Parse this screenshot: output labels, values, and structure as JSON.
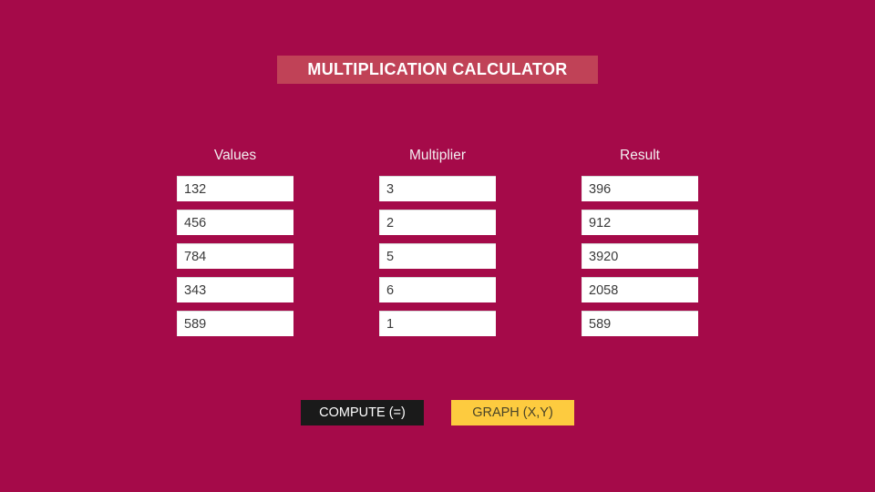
{
  "app": {
    "background_color": "#a50a49",
    "title_bar_color": "#c04257"
  },
  "header": {
    "title": "MULTIPLICATION CALCULATOR"
  },
  "table": {
    "columns": [
      {
        "key": "values",
        "header": "Values",
        "cells": [
          "132",
          "456",
          "784",
          "343",
          "589"
        ]
      },
      {
        "key": "multiplier",
        "header": "Multiplier",
        "cells": [
          "3",
          "2",
          "5",
          "6",
          "1"
        ]
      },
      {
        "key": "result",
        "header": "Result",
        "cells": [
          "396",
          "912",
          "3920",
          "2058",
          "589"
        ]
      }
    ]
  },
  "buttons": {
    "compute": {
      "label": "COMPUTE (=)",
      "background_color": "#1a1a1a",
      "text_color": "#ffffff"
    },
    "graph": {
      "label": "GRAPH (X,Y)",
      "background_color": "#fdcb3f",
      "text_color": "#4a4428"
    }
  }
}
